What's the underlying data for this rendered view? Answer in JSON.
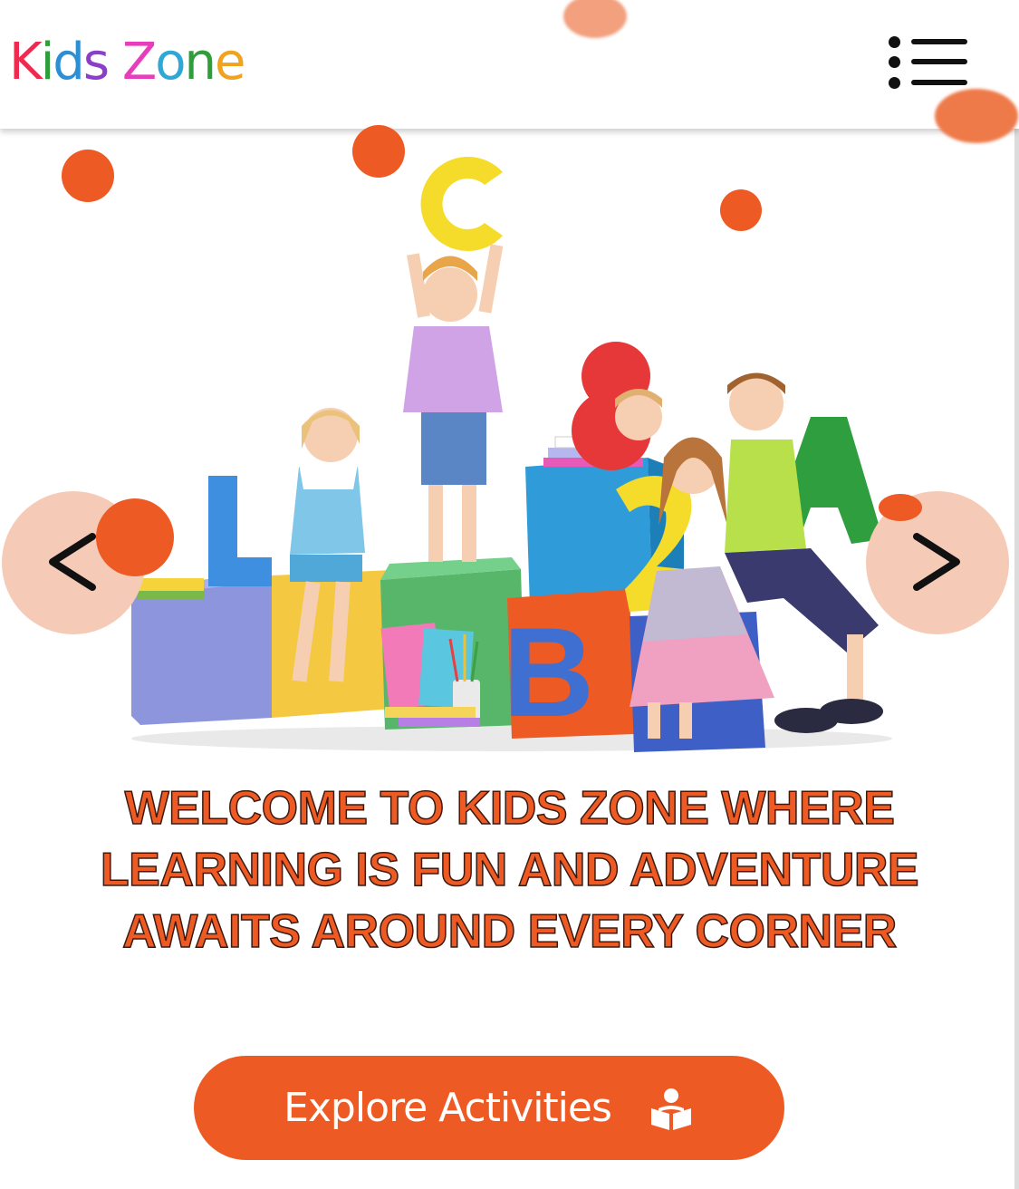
{
  "header": {
    "logo_letters": [
      {
        "char": "K",
        "color": "#ee2a4e"
      },
      {
        "char": "i",
        "color": "#2e9e3a"
      },
      {
        "char": "d",
        "color": "#2c8fd6"
      },
      {
        "char": "s",
        "color": "#8b3fc9"
      },
      {
        "char": " ",
        "color": "#ffffff"
      },
      {
        "char": "Z",
        "color": "#e83dbb"
      },
      {
        "char": "o",
        "color": "#2fa8d8"
      },
      {
        "char": "n",
        "color": "#2e9e3a"
      },
      {
        "char": "e",
        "color": "#f0a31c"
      }
    ],
    "menu_icon": "list-menu-icon"
  },
  "hero": {
    "prev_icon": "chevron-left-icon",
    "next_icon": "chevron-right-icon",
    "welcome_text": "Welcome to Kids Zone where learning is fun and adventure awaits around every corner",
    "cta_label": "Explore Activities",
    "cta_icon": "reading-book-icon"
  },
  "colors": {
    "accent": "#ee5a24",
    "accent_soft": "#f5cbb8",
    "text_dark": "#111111"
  }
}
